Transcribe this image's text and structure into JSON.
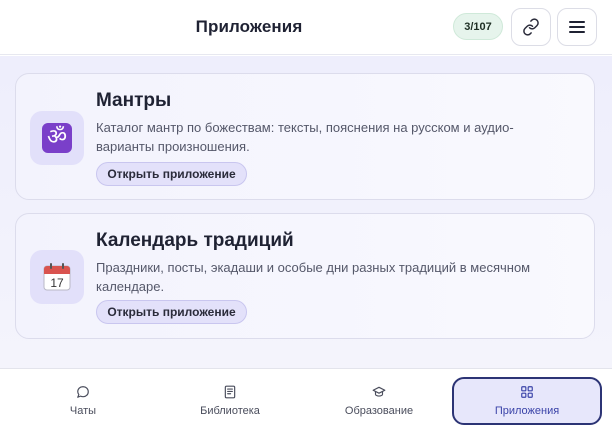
{
  "header": {
    "title": "Приложения",
    "counter": "3/107",
    "link_icon": "link-icon",
    "menu_icon": "hamburger-menu-icon"
  },
  "apps": [
    {
      "icon": "om-icon",
      "glyph": "ॐ",
      "title": "Мантры",
      "description": "Каталог мантр по божествам: тексты, пояснения на русском и аудио-варианты произношения.",
      "button_label": "Открыть приложение"
    },
    {
      "icon": "calendar-icon",
      "glyph": "📅",
      "title": "Календарь традиций",
      "description": "Праздники, посты, экадаши и особые дни разных традиций в месячном календаре.",
      "button_label": "Открыть приложение"
    }
  ],
  "calendar_icon_day": "17",
  "tabs": [
    {
      "label": "Чаты",
      "icon": "chat-bubble-icon",
      "active": false
    },
    {
      "label": "Библиотека",
      "icon": "book-icon",
      "active": false
    },
    {
      "label": "Образование",
      "icon": "graduation-cap-icon",
      "active": false
    },
    {
      "label": "Приложения",
      "icon": "grid-icon",
      "active": true
    }
  ],
  "colors": {
    "accent": "#3a43a8",
    "active_tab_border": "#2c3475",
    "badge_bg": "#e6f4ec",
    "button_bg": "#e3e1fa"
  }
}
